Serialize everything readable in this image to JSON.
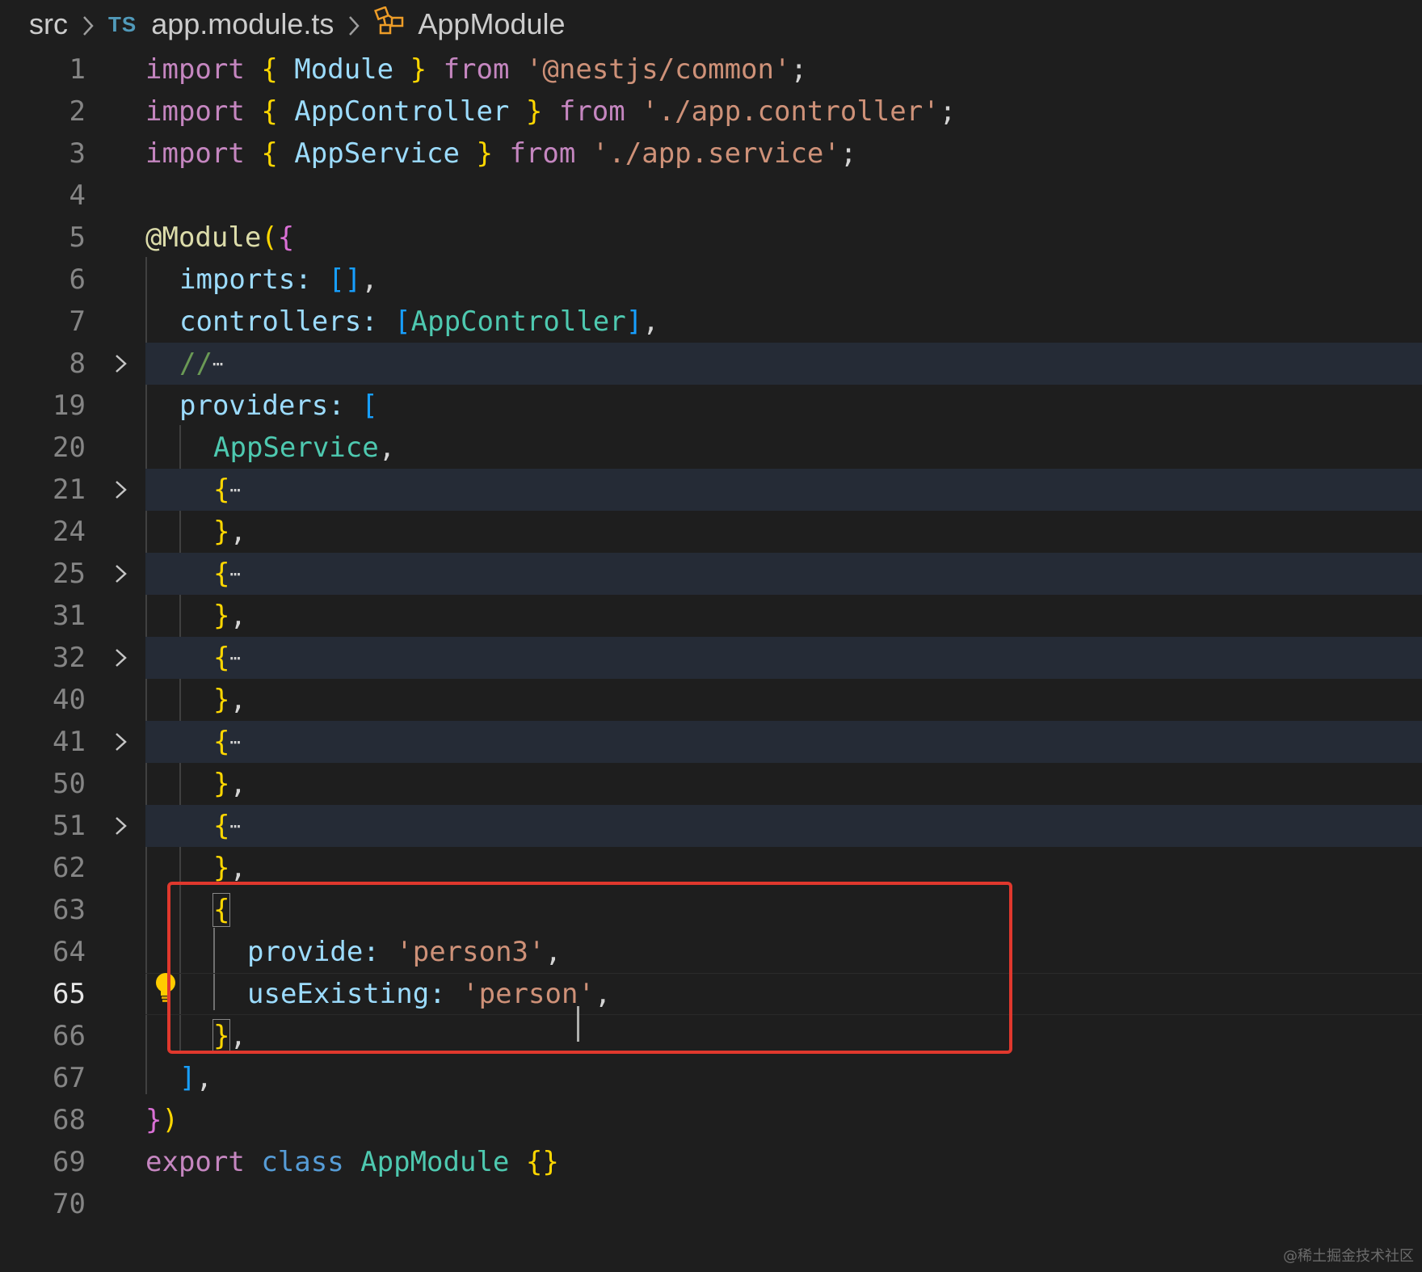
{
  "breadcrumb": {
    "folder": "src",
    "file_badge": "TS",
    "file": "app.module.ts",
    "symbol": "AppModule"
  },
  "icons": {
    "separator": "chevron-right-icon",
    "file_type": "typescript-icon",
    "symbol": "module-symbol-icon",
    "fold": "chevron-right-icon",
    "lightbulb": "lightbulb-icon"
  },
  "colors": {
    "background": "#1e1e1e",
    "keyword": "#c586c0",
    "storage": "#569cd6",
    "class": "#4ec9b0",
    "string": "#ce9178",
    "variable": "#9cdcfe",
    "bracket_gold": "#ffd700",
    "bracket_orchid": "#da70d6",
    "bracket_blue": "#179fff",
    "highlight_box": "#e0382d"
  },
  "editor": {
    "active_line": "65",
    "lines": [
      {
        "number": "1"
      },
      {
        "number": "2"
      },
      {
        "number": "3"
      },
      {
        "number": "4"
      },
      {
        "number": "5"
      },
      {
        "number": "6"
      },
      {
        "number": "7"
      },
      {
        "number": "8"
      },
      {
        "number": "19"
      },
      {
        "number": "20"
      },
      {
        "number": "21"
      },
      {
        "number": "24"
      },
      {
        "number": "25"
      },
      {
        "number": "31"
      },
      {
        "number": "32"
      },
      {
        "number": "40"
      },
      {
        "number": "41"
      },
      {
        "number": "50"
      },
      {
        "number": "51"
      },
      {
        "number": "62"
      },
      {
        "number": "63"
      },
      {
        "number": "64"
      },
      {
        "number": "65"
      },
      {
        "number": "66"
      },
      {
        "number": "67"
      },
      {
        "number": "68"
      },
      {
        "number": "69"
      },
      {
        "number": "70"
      }
    ],
    "code": {
      "import": "import",
      "from": "from",
      "export": "export",
      "class": "class",
      "Module": "Module",
      "AppController": "AppController",
      "AppService": "AppService",
      "AppModule": "AppModule",
      "common_path": "'@nestjs/common'",
      "controller_path": "'./app.controller'",
      "service_path": "'./app.service'",
      "decorator": "@Module",
      "imports_key": "imports",
      "controllers_key": "controllers",
      "providers_key": "providers",
      "comment": "//",
      "ellipsis": "⋯",
      "provide_key": "provide",
      "provide_value": "'person3'",
      "use_existing_key": "useExisting",
      "use_existing_value_before_cursor": "'person",
      "use_existing_value_after_cursor": "'"
    }
  },
  "watermark": "@稀土掘金技术社区"
}
